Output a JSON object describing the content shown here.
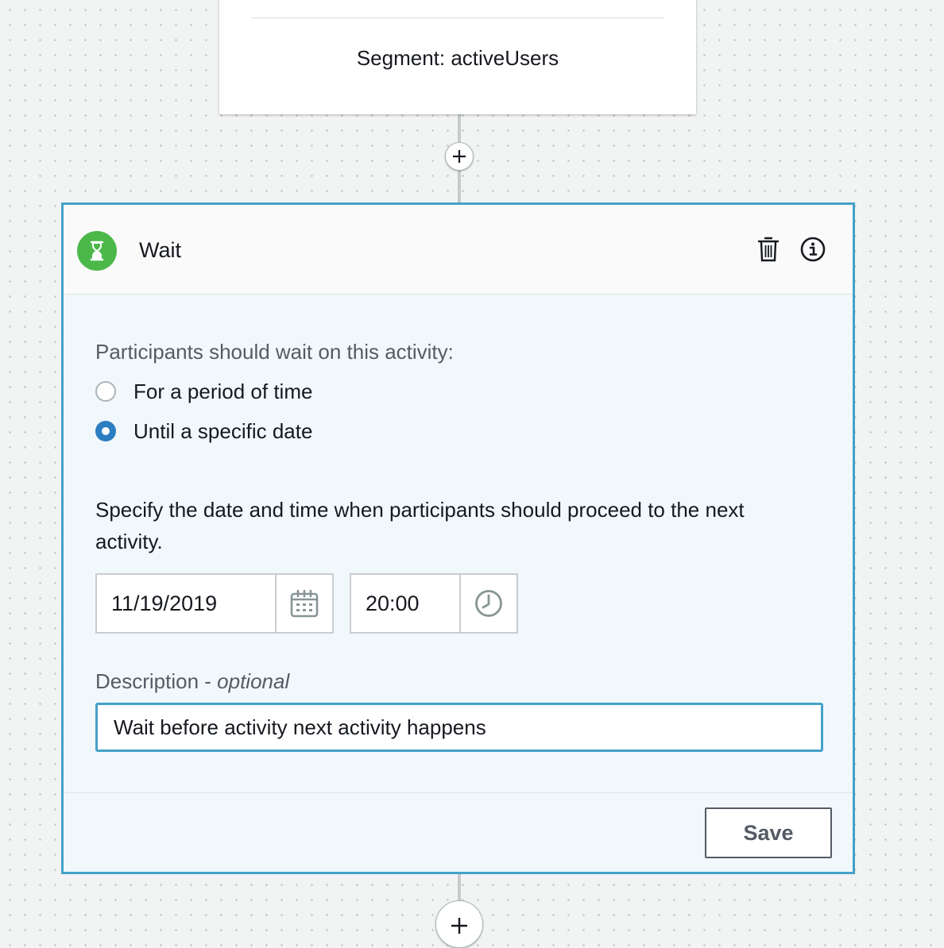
{
  "segment_card": {
    "label": "Segment: activeUsers"
  },
  "wait_card": {
    "icon": "hourglass-icon",
    "title": "Wait",
    "header_icons": [
      "trash-icon",
      "info-icon"
    ],
    "question": "Participants should wait on this activity:",
    "options": [
      {
        "label": "For a period of time",
        "selected": false
      },
      {
        "label": "Until a specific date",
        "selected": true
      }
    ],
    "instruction": "Specify the date and time when participants should proceed to the next activity.",
    "date_value": "11/19/2019",
    "time_value": "20:00",
    "description_label": "Description - ",
    "description_optional": "optional",
    "description_value": "Wait before activity next activity happens",
    "save_label": "Save"
  },
  "colors": {
    "accent_border": "#44a1c8",
    "wait_icon_bg": "#4cb84a",
    "radio_selected": "#2b7ec1",
    "card_body_bg": "#f1f8fc"
  }
}
